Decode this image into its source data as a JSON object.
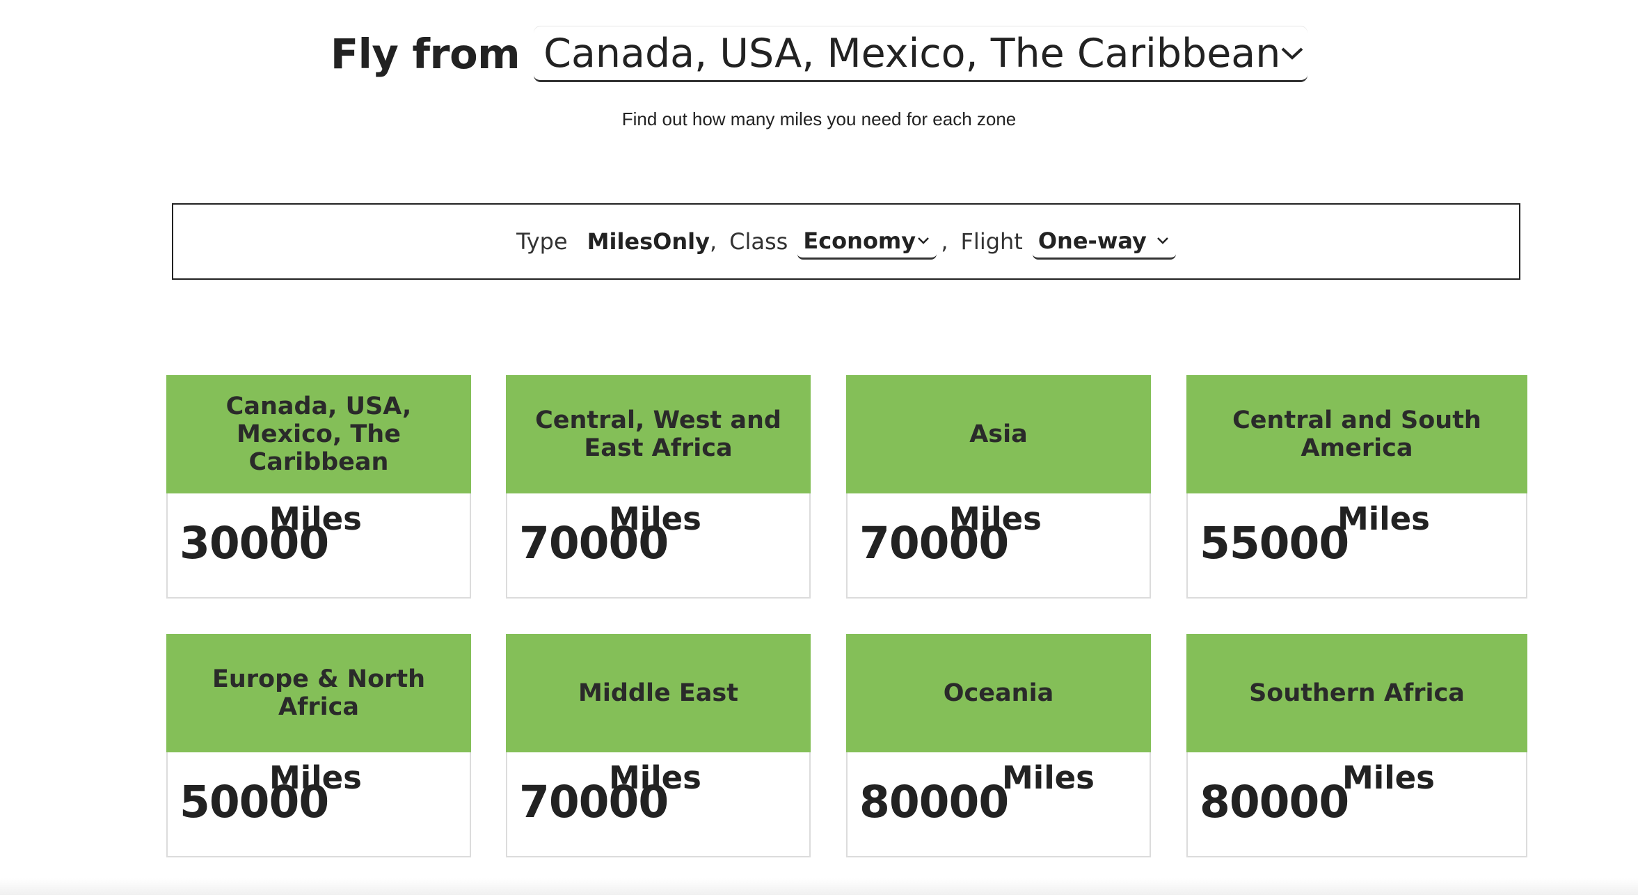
{
  "header": {
    "fly_from_label": "Fly from",
    "origin_selected": "Canada, USA, Mexico, The Caribbean",
    "subtitle": "Find out how many miles you need for each zone"
  },
  "filters": {
    "type_label": "Type",
    "type_value": "MilesOnly",
    "class_label": "Class",
    "class_value": "Economy",
    "flight_label": "Flight",
    "flight_value": "One-way",
    "separator": ","
  },
  "zones": [
    {
      "name": "Canada, USA, Mexico, The Caribbean",
      "miles": "30000",
      "unit": "Miles"
    },
    {
      "name": "Central, West and East Africa",
      "miles": "70000",
      "unit": "Miles"
    },
    {
      "name": "Asia",
      "miles": "70000",
      "unit": "Miles"
    },
    {
      "name": "Central and South America",
      "miles": "55000",
      "unit": "Miles"
    },
    {
      "name": "Europe & North Africa",
      "miles": "50000",
      "unit": "Miles"
    },
    {
      "name": "Middle East",
      "miles": "70000",
      "unit": "Miles"
    },
    {
      "name": "Oceania",
      "miles": "80000",
      "unit": "Miles"
    },
    {
      "name": "Southern Africa",
      "miles": "80000",
      "unit": "Miles"
    }
  ],
  "colors": {
    "card_header": "#84bf58",
    "text": "#222222"
  },
  "icons": {
    "dropdown": "chevron-down-icon"
  }
}
